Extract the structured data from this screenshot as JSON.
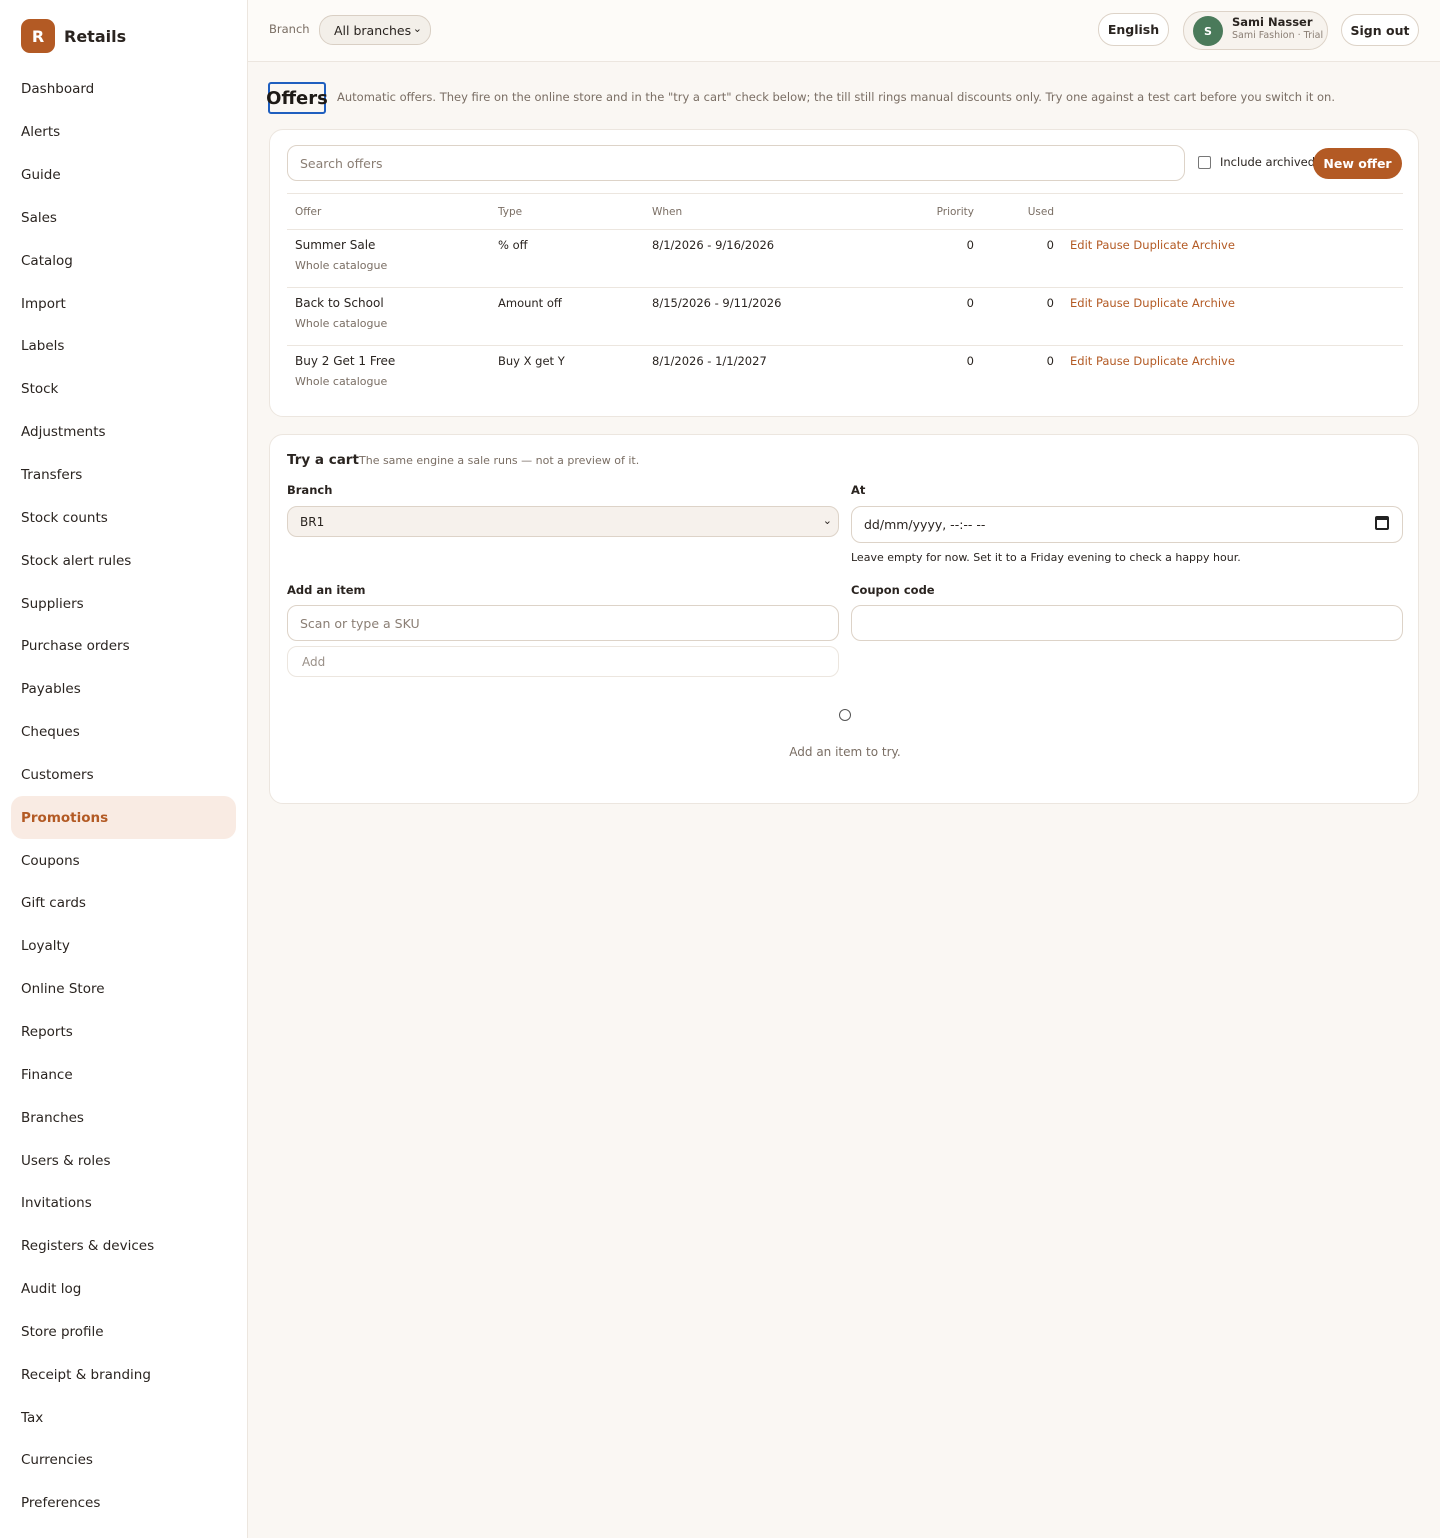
{
  "brand": {
    "mark": "R",
    "name": "Retails"
  },
  "nav": [
    "Dashboard",
    "Alerts",
    "Guide",
    "Sales",
    "Catalog",
    "Import",
    "Labels",
    "Stock",
    "Adjustments",
    "Transfers",
    "Stock counts",
    "Stock alert rules",
    "Suppliers",
    "Purchase orders",
    "Payables",
    "Cheques",
    "Customers",
    "Promotions",
    "Coupons",
    "Gift cards",
    "Loyalty",
    "Online Store",
    "Reports",
    "Finance",
    "Branches",
    "Users & roles",
    "Invitations",
    "Registers & devices",
    "Audit log",
    "Store profile",
    "Receipt & branding",
    "Tax",
    "Currencies",
    "Preferences"
  ],
  "active_nav": "Promotions",
  "topbar": {
    "branch_label": "Branch",
    "branch_value": "All branches",
    "language": "English",
    "user_initial": "S",
    "user_name": "Sami Nasser",
    "user_org": "Sami Fashion · Trial",
    "sign_out": "Sign out"
  },
  "page": {
    "title": "Offers",
    "description": "Automatic offers. They fire on the online store and in the \"try a cart\" check below; the till still rings manual discounts only. Try one against a test cart before you switch it on."
  },
  "offers": {
    "search_placeholder": "Search offers",
    "include_archived": "Include archived",
    "new_offer": "New offer",
    "columns": {
      "offer": "Offer",
      "type": "Type",
      "when": "When",
      "priority": "Priority",
      "used": "Used"
    },
    "rows": [
      {
        "name": "Summer Sale",
        "scope": "Whole catalogue",
        "type": "% off",
        "when": "8/1/2026 - 9/16/2026",
        "priority": "0",
        "used": "0"
      },
      {
        "name": "Back to School",
        "scope": "Whole catalogue",
        "type": "Amount off",
        "when": "8/15/2026 - 9/11/2026",
        "priority": "0",
        "used": "0"
      },
      {
        "name": "Buy 2 Get 1 Free",
        "scope": "Whole catalogue",
        "type": "Buy X get Y",
        "when": "8/1/2026 - 1/1/2027",
        "priority": "0",
        "used": "0"
      }
    ],
    "actions": {
      "edit": "Edit",
      "pause": "Pause",
      "duplicate": "Duplicate",
      "archive": "Archive"
    }
  },
  "cart": {
    "title": "Try a cart",
    "subtitle": "The same engine a sale runs — not a preview of it.",
    "branch_label": "Branch",
    "branch_value": "BR1",
    "at_label": "At",
    "at_placeholder": "dd/mm/yyyy, --:-- --",
    "at_hint": "Leave empty for now. Set it to a Friday evening to check a happy hour.",
    "item_label": "Add an item",
    "item_placeholder": "Scan or type a SKU",
    "add_button": "Add",
    "coupon_label": "Coupon code",
    "coupon_value": "",
    "empty_text": "Add an item to try."
  },
  "colors": {
    "accent": "#b35a24",
    "active_bg": "#f9ebe3",
    "avatar": "#4a7a5a",
    "focus": "#1f5fbf"
  }
}
